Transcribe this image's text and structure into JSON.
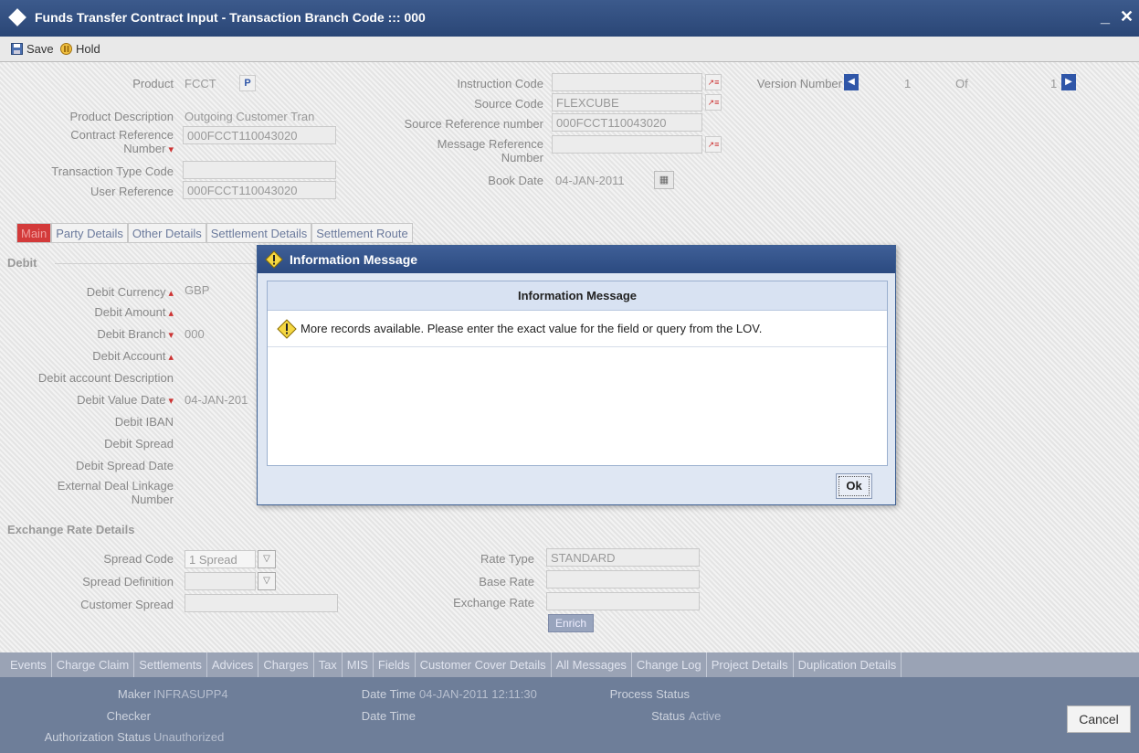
{
  "window": {
    "title": "Funds Transfer Contract Input - Transaction Branch Code ::: 000",
    "minimize": "_",
    "close": "✕"
  },
  "toolbar": {
    "save_label": "Save",
    "hold_label": "Hold"
  },
  "header": {
    "product_label": "Product",
    "product_value": "FCCT",
    "product_btn": "P",
    "product_desc_label": "Product Description",
    "product_desc_value": "Outgoing Customer Tran",
    "contract_ref_label": "Contract Reference Number",
    "contract_ref_value": "000FCCT110043020",
    "txn_type_label": "Transaction Type Code",
    "txn_type_value": "",
    "user_ref_label": "User Reference",
    "user_ref_value": "000FCCT110043020",
    "instruction_code_label": "Instruction Code",
    "instruction_code_value": "",
    "source_code_label": "Source Code",
    "source_code_value": "FLEXCUBE",
    "source_ref_label": "Source Reference number",
    "source_ref_value": "000FCCT110043020",
    "msg_ref_label": "Message Reference Number",
    "msg_ref_value": "",
    "book_date_label": "Book Date",
    "book_date_value": "04-JAN-2011",
    "version_label": "Version Number",
    "version_value": "1",
    "version_of": "Of",
    "version_total": "1"
  },
  "tabs": [
    "Main",
    "Party Details",
    "Other Details",
    "Settlement Details",
    "Settlement Route"
  ],
  "debit": {
    "section": "Debit",
    "currency_label": "Debit Currency",
    "currency_value": "GBP",
    "amount_label": "Debit Amount",
    "branch_label": "Debit Branch",
    "branch_value": "000",
    "account_label": "Debit Account",
    "account_desc_label": "Debit account Description",
    "value_date_label": "Debit Value Date",
    "value_date_value": "04-JAN-201",
    "iban_label": "Debit IBAN",
    "spread_label": "Debit Spread",
    "spread_date_label": "Debit Spread Date",
    "ext_deal_label": "External Deal Linkage Number"
  },
  "exchange": {
    "section": "Exchange Rate Details",
    "spread_code_label": "Spread Code",
    "spread_code_value": "1 Spread",
    "spread_def_label": "Spread Definition",
    "customer_spread_label": "Customer Spread",
    "rate_type_label": "Rate Type",
    "rate_type_value": "STANDARD",
    "base_rate_label": "Base Rate",
    "exchange_rate_label": "Exchange Rate",
    "enrich_label": "Enrich"
  },
  "bottom_tabs": [
    "Events",
    "Charge Claim",
    "Settlements",
    "Advices",
    "Charges",
    "Tax",
    "MIS",
    "Fields",
    "Customer Cover Details",
    "All Messages",
    "Change Log",
    "Project Details",
    "Duplication Details"
  ],
  "status": {
    "maker_label": "Maker",
    "maker_value": "INFRASUPP4",
    "checker_label": "Checker",
    "auth_label": "Authorization Status",
    "auth_value": "Unauthorized",
    "datetime_label": "Date Time",
    "datetime_value": "04-JAN-2011 12:11:30",
    "datetime2_label": "Date Time",
    "process_label": "Process Status",
    "status_label": "Status",
    "status_value": "Active",
    "cancel_label": "Cancel"
  },
  "dialog": {
    "title": "Information Message",
    "header": "Information Message",
    "message": "More records available. Please enter the exact value for the field or query from the LOV.",
    "ok_label": "Ok"
  },
  "colors": {
    "accent": "#2b4a80",
    "active_tab": "#d33a3a",
    "status_bg": "#6e7e99"
  }
}
